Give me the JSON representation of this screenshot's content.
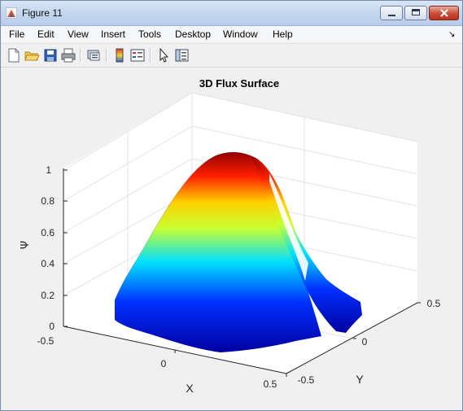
{
  "window": {
    "title": "Figure 11"
  },
  "menu": [
    "File",
    "Edit",
    "View",
    "Insert",
    "Tools",
    "Desktop",
    "Window",
    "Help"
  ],
  "menu_arrow": "↘",
  "toolbar": [
    "new-figure-icon",
    "open-file-icon",
    "save-icon",
    "print-icon",
    "print-preview-icon",
    "colorbar-icon",
    "legend-icon",
    "pointer-icon",
    "property-editor-icon"
  ],
  "colors": {
    "surface_top": "#800000",
    "surface_bottom": "#00008f",
    "axes_bg": "#ffffff",
    "grid": "#e3e3e3"
  },
  "chart_data": {
    "type": "surface",
    "title": "3D Flux Surface",
    "xlabel": "X",
    "ylabel": "Y",
    "zlabel": "Ψ",
    "x_ticks": [
      "-0.5",
      "0",
      "0.5"
    ],
    "y_ticks": [
      "-0.5",
      "0",
      "0.5"
    ],
    "z_ticks": [
      "0",
      "0.2",
      "0.4",
      "0.6",
      "0.8",
      "1"
    ],
    "xlim": [
      -0.5,
      0.5
    ],
    "ylim": [
      -0.5,
      0.5
    ],
    "zlim": [
      0,
      1
    ],
    "colormap": "jet",
    "peak": {
      "x": 0,
      "y": 0,
      "z": 1
    },
    "grid": true
  }
}
